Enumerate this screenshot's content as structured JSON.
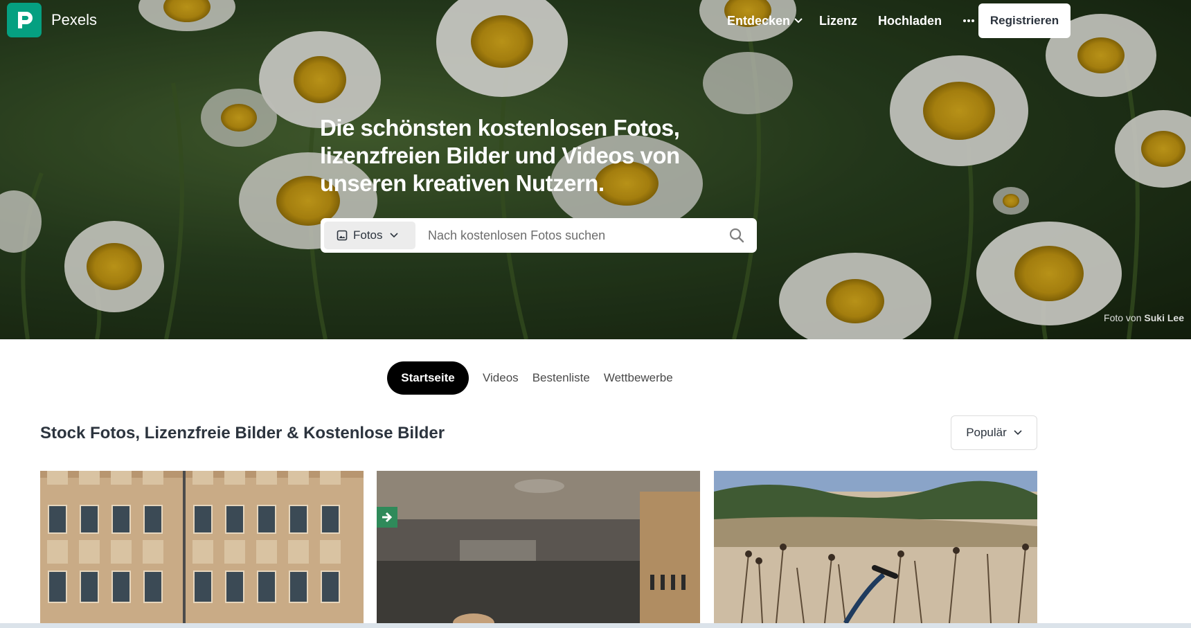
{
  "brand": {
    "name": "Pexels",
    "color": "#05a081"
  },
  "nav": {
    "explore": "Entdecken",
    "license": "Lizenz",
    "upload": "Hochladen",
    "more": "···",
    "join": "Registrieren"
  },
  "hero": {
    "headline": "Die schönsten kostenlosen Fotos, lizenzfreien Bilder und Videos von unseren kreativen Nutzern.",
    "search": {
      "type_label": "Fotos",
      "placeholder": "Nach kostenlosen Fotos suchen"
    },
    "credit_prefix": "Foto von",
    "credit_author": "Suki Lee"
  },
  "tabs": [
    {
      "label": "Startseite",
      "active": true
    },
    {
      "label": "Videos",
      "active": false
    },
    {
      "label": "Bestenliste",
      "active": false
    },
    {
      "label": "Wettbewerbe",
      "active": false
    }
  ],
  "section": {
    "title": "Stock Fotos, Lizenzfreie Bilder & Kostenlose Bilder",
    "sort_label": "Populär"
  },
  "icons": {
    "search": "search-icon",
    "image": "image-icon",
    "chevron": "chevron-down-icon",
    "more": "more-dots-icon"
  }
}
